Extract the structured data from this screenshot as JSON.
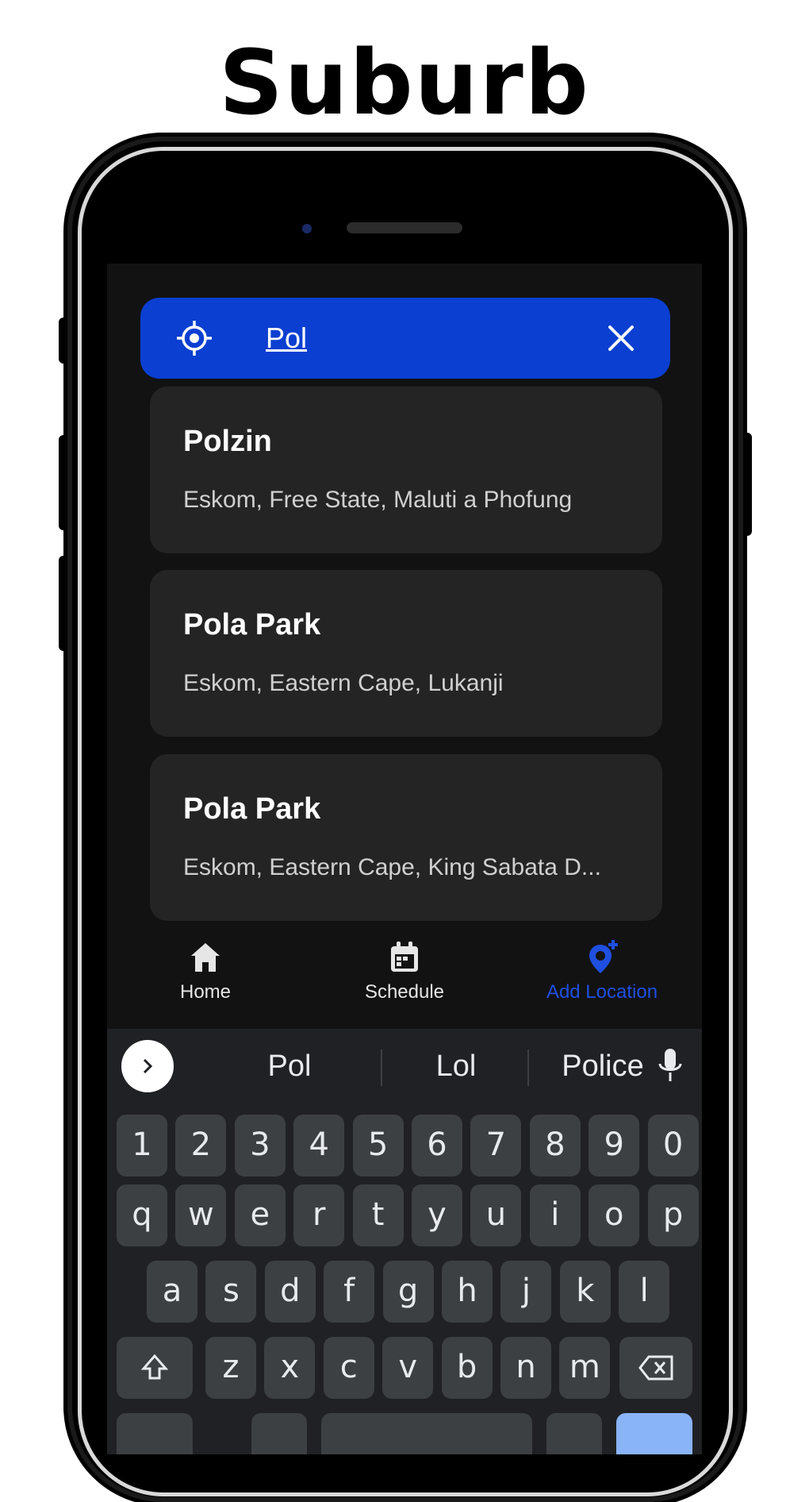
{
  "headline": "Suburb",
  "search": {
    "value": "Pol",
    "icon": "my-location-icon",
    "clear_icon": "close-icon"
  },
  "results": [
    {
      "title": "Polzin",
      "subtitle": "Eskom, Free State, Maluti a Phofung"
    },
    {
      "title": "Pola Park",
      "subtitle": "Eskom, Eastern Cape, Lukanji"
    },
    {
      "title": "Pola Park",
      "subtitle": "Eskom, Eastern Cape, King Sabata D..."
    }
  ],
  "nav": {
    "items": [
      {
        "label": "Home",
        "icon": "home-icon"
      },
      {
        "label": "Schedule",
        "icon": "calendar-icon"
      },
      {
        "label": "Add Location",
        "icon": "add-location-icon"
      }
    ],
    "active_index": 2
  },
  "keyboard": {
    "suggestions": [
      "Pol",
      "Lol",
      "Police"
    ],
    "number_row": [
      "1",
      "2",
      "3",
      "4",
      "5",
      "6",
      "7",
      "8",
      "9",
      "0"
    ],
    "row1": [
      "q",
      "w",
      "e",
      "r",
      "t",
      "y",
      "u",
      "i",
      "o",
      "p"
    ],
    "row2": [
      "a",
      "s",
      "d",
      "f",
      "g",
      "h",
      "j",
      "k",
      "l"
    ],
    "row3": [
      "z",
      "x",
      "c",
      "v",
      "b",
      "n",
      "m"
    ]
  },
  "colors": {
    "accent": "#0a3fd1",
    "screen_bg": "#121212",
    "card_bg": "#242424",
    "keyboard_bg": "#202124",
    "key_bg": "#3c4043",
    "enter_key": "#8ab4f8"
  }
}
